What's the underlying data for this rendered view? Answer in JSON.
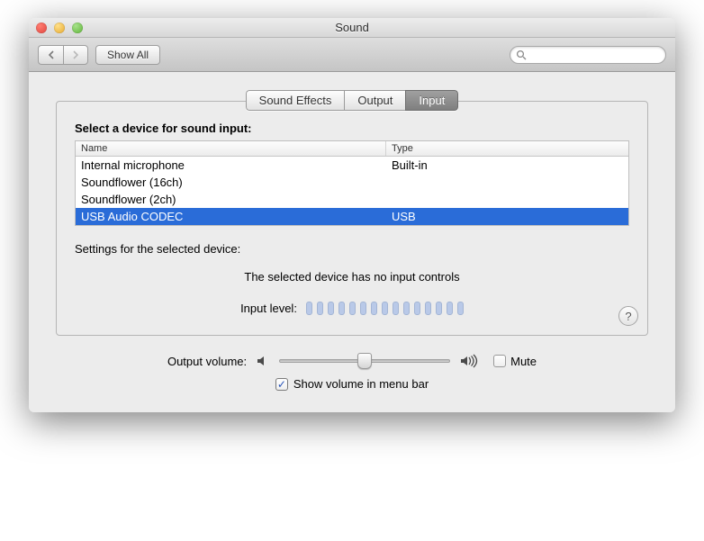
{
  "window_title": "Sound",
  "toolbar": {
    "show_all_label": "Show All",
    "search_placeholder": ""
  },
  "tabs": [
    {
      "label": "Sound Effects",
      "active": false
    },
    {
      "label": "Output",
      "active": false
    },
    {
      "label": "Input",
      "active": true
    }
  ],
  "section_label": "Select a device for sound input:",
  "columns": {
    "name": "Name",
    "type": "Type"
  },
  "devices": [
    {
      "name": "Internal microphone",
      "type": "Built-in",
      "selected": false
    },
    {
      "name": "Soundflower (16ch)",
      "type": "",
      "selected": false
    },
    {
      "name": "Soundflower (2ch)",
      "type": "",
      "selected": false
    },
    {
      "name": "USB Audio CODEC",
      "type": "USB",
      "selected": true
    }
  ],
  "settings_label": "Settings for the selected device:",
  "no_controls_message": "The selected device has no input controls",
  "input_level_label": "Input level:",
  "input_level_leds": 15,
  "output_volume_label": "Output volume:",
  "output_volume_percent": 50,
  "mute_label": "Mute",
  "mute_checked": false,
  "show_volume_label": "Show volume in menu bar",
  "show_volume_checked": true,
  "help_label": "?"
}
